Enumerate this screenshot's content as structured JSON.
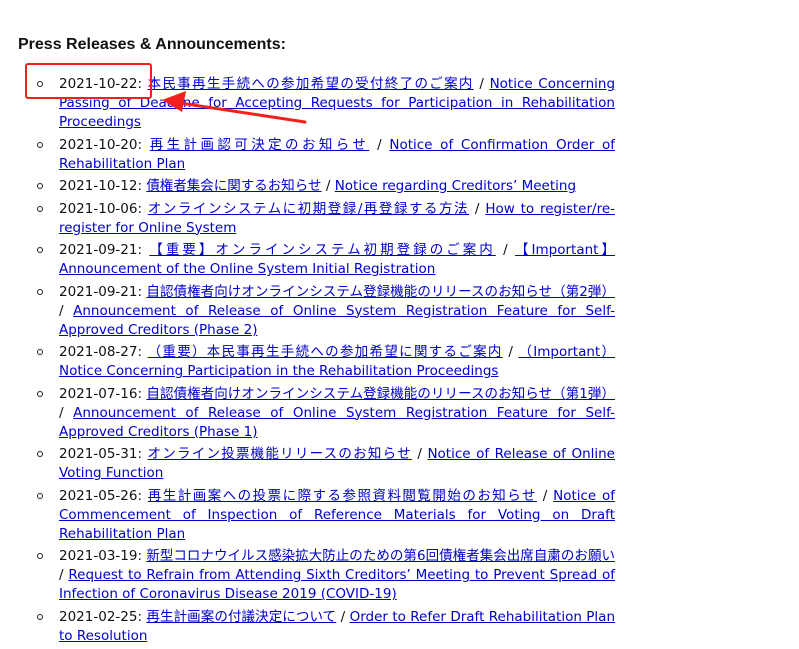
{
  "heading": "Press Releases & Announcements:",
  "separator": "/",
  "releases": [
    {
      "date": "2021-10-22:",
      "jp": "本民事再生手続への参加希望の受付終了のご案内",
      "en": "Notice Concerning Passing of Deadline for Accepting Requests for Participation in Rehabilitation Proceedings"
    },
    {
      "date": "2021-10-20:",
      "jp": "再生計画認可決定のお知らせ",
      "en": "Notice of Confirmation Order of Rehabilitation Plan"
    },
    {
      "date": "2021-10-12:",
      "jp": "債権者集会に関するお知らせ",
      "en": "Notice regarding Creditors’ Meeting"
    },
    {
      "date": "2021-10-06:",
      "jp": "オンラインシステムに初期登録/再登録する方法",
      "en": "How to register/re-register for Online System"
    },
    {
      "date": "2021-09-21:",
      "jp": "【重要】オンラインシステム初期登録のご案内",
      "en": "【Important】Announcement of the Online System Initial Registration"
    },
    {
      "date": "2021-09-21:",
      "jp": "自認債権者向けオンラインシステム登録機能のリリースのお知らせ（第2弾）",
      "en": "Announcement of Release of Online System Registration Feature for Self-Approved Creditors (Phase 2)"
    },
    {
      "date": "2021-08-27:",
      "jp": "（重要）本民事再生手続への参加希望に関するご案内",
      "en": "（Important）Notice Concerning Participation in the Rehabilitation Proceedings"
    },
    {
      "date": "2021-07-16:",
      "jp": "自認債権者向けオンラインシステム登録機能のリリースのお知らせ（第1弾）",
      "en": "Announcement of Release of Online System Registration Feature for Self-Approved Creditors (Phase 1)"
    },
    {
      "date": "2021-05-31:",
      "jp": "オンライン投票機能リリースのお知らせ",
      "en": "Notice of Release of Online Voting Function"
    },
    {
      "date": "2021-05-26:",
      "jp": "再生計画案への投票に際する参照資料閲覧開始のお知らせ",
      "en": "Notice of Commencement of Inspection of Reference Materials for Voting on Draft Rehabilitation Plan"
    },
    {
      "date": "2021-03-19:",
      "jp": "新型コロナウイルス感染拡大防止のための第6回債権者集会出席自粛のお願い",
      "en": "Request to Refrain from Attending Sixth Creditors’ Meeting to Prevent Spread of Infection of Coronavirus Disease 2019 (COVID-19)"
    },
    {
      "date": "2021-02-25:",
      "jp": "再生計画案の付議決定について",
      "en": "Order to Refer Draft Rehabilitation Plan to Resolution"
    }
  ],
  "colors": {
    "link": "#0000cc",
    "annotation": "#f2201c"
  }
}
